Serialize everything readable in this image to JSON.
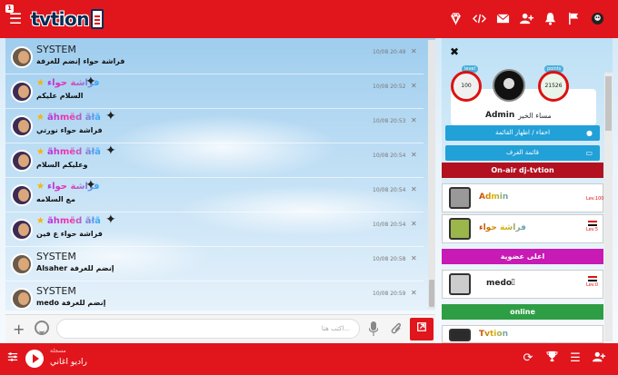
{
  "app": {
    "logo_text": "tvtion",
    "notification_count": "1"
  },
  "topbar": {
    "icons": [
      "diamond-icon",
      "code-icon",
      "mail-icon",
      "add-friend-icon",
      "bell-icon",
      "flag-icon",
      "user-avatar"
    ]
  },
  "chat": {
    "messages": [
      {
        "user": "SYSTEM",
        "text": "فراشة حواء إنضم للغرفة",
        "time": "10/08 20:49",
        "style": "system"
      },
      {
        "user": "فراشة حواء",
        "text": "السلام عليكم",
        "time": "10/08 20:52",
        "style": "fancy"
      },
      {
        "user": "ãhmëd ãłã",
        "text": "فراشة حواء نورتي",
        "time": "10/08 20:53",
        "style": "fancy"
      },
      {
        "user": "ãhmëd ãłã",
        "text": "وعليكم السلام",
        "time": "10/08 20:54",
        "style": "fancy"
      },
      {
        "user": "فراشة حواء",
        "text": "مع السلامه",
        "time": "10/08 20:54",
        "style": "fancy"
      },
      {
        "user": "ãhmëd ãłã",
        "text": "فراشة حواء ع فين",
        "time": "10/08 20:54",
        "style": "fancy"
      },
      {
        "user": "SYSTEM",
        "text": "Alsaher إنضم للغرفة",
        "time": "10/08 20:58",
        "style": "system"
      },
      {
        "user": "SYSTEM",
        "text": "medo إنضم للغرفة",
        "time": "10/08 20:59",
        "style": "system"
      }
    ],
    "input_placeholder": "اكتب هنا..."
  },
  "profile": {
    "level_label": "level",
    "level_value": "100",
    "points_label": "points",
    "points_value": "21526",
    "name": "Admin",
    "greeting": "مساء الخير"
  },
  "right_panel": {
    "btn_toggle_list": "اخفاء / اظهار القائمة",
    "btn_rooms_list": "قائمة الغرف",
    "section_onair": "On-air dj-tvtion",
    "section_members": "اعلى عضوية",
    "section_online": "online",
    "onair_users": [
      {
        "name": "Admin",
        "rank": "Lev.100"
      },
      {
        "name": "فراشة حواء",
        "rank": "Lev.5"
      }
    ],
    "member_users": [
      {
        "name": "medo",
        "rank": "Lev.0"
      }
    ],
    "online_users": [
      {
        "name": "Tvtion"
      }
    ]
  },
  "bottombar": {
    "radio_title": "مسجلة",
    "radio_name": "راديو اغاني"
  }
}
